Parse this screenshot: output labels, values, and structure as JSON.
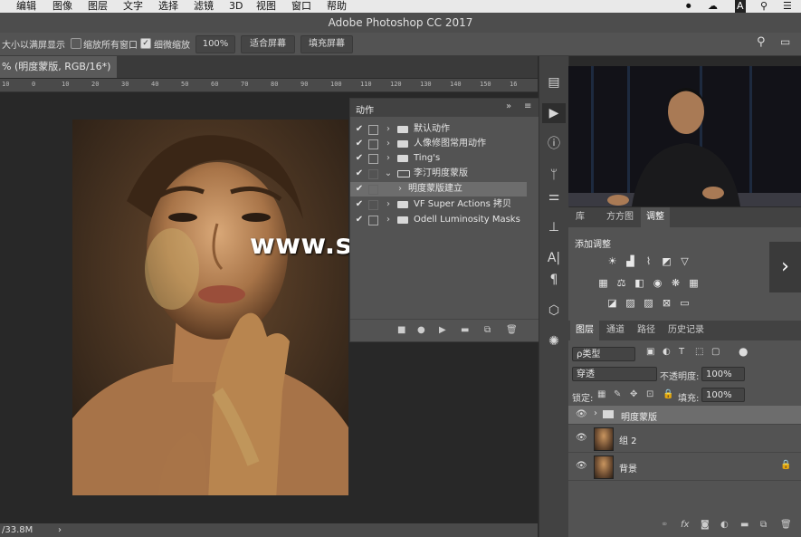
{
  "menubar": {
    "items": [
      "",
      "编辑",
      "图像",
      "图层",
      "文字",
      "选择",
      "滤镜",
      "3D",
      "视图",
      "窗口",
      "帮助"
    ],
    "right_icons": [
      "video-icon",
      "creative-cloud-icon",
      "adobe-icon",
      "search-icon",
      "list-icon"
    ]
  },
  "titlebar": {
    "title": "Adobe Photoshop CC 2017"
  },
  "options": {
    "resize_label": "大小以满屏显示",
    "zoom_all_label": "缩放所有窗口",
    "scrubby_label": "细微缩放",
    "zoom_value": "100%",
    "fit_screen": "适合屏幕",
    "fill_screen": "填充屏幕"
  },
  "document": {
    "tab_title": "% (明度蒙版, RGB/16*) *",
    "status": "/33.8M",
    "ruler_ticks": [
      "10",
      "0",
      "10",
      "20",
      "30",
      "40",
      "50",
      "60",
      "70",
      "80",
      "90",
      "100",
      "110",
      "120",
      "130",
      "140",
      "150",
      "16"
    ]
  },
  "actions_panel": {
    "title": "动作",
    "rows": [
      {
        "label": "默认动作",
        "checked": true,
        "dialog": true,
        "type": "set"
      },
      {
        "label": "人像修图常用动作",
        "checked": true,
        "dialog": true,
        "type": "set"
      },
      {
        "label": "Ting's",
        "checked": true,
        "dialog": true,
        "type": "set"
      },
      {
        "label": "李汀明度蒙版",
        "checked": true,
        "dialog": false,
        "type": "set-open"
      },
      {
        "label": "明度蒙版建立",
        "checked": true,
        "dialog": false,
        "type": "action"
      },
      {
        "label": "VF Super Actions 拷贝",
        "checked": true,
        "dialog": false,
        "type": "set"
      },
      {
        "label": "Odell Luminosity Masks",
        "checked": true,
        "dialog": true,
        "type": "set"
      }
    ]
  },
  "watermark": {
    "text": "www.shejifuzhu.com"
  },
  "adjust_panel": {
    "tabs": [
      "库",
      "方方图",
      "调整"
    ],
    "heading": "添加调整"
  },
  "layers_panel": {
    "tabs": [
      "图层",
      "通道",
      "路径",
      "历史记录"
    ],
    "filter_kind": "ρ类型",
    "blend_mode": "穿透",
    "opacity_label": "不透明度:",
    "opacity_value": "100%",
    "lock_label": "锁定:",
    "fill_label": "填充:",
    "fill_value": "100%",
    "layers": [
      {
        "name": "明度蒙版",
        "type": "group"
      },
      {
        "name": "组 2",
        "type": "layer"
      },
      {
        "name": "背景",
        "type": "background",
        "locked": true
      }
    ]
  }
}
